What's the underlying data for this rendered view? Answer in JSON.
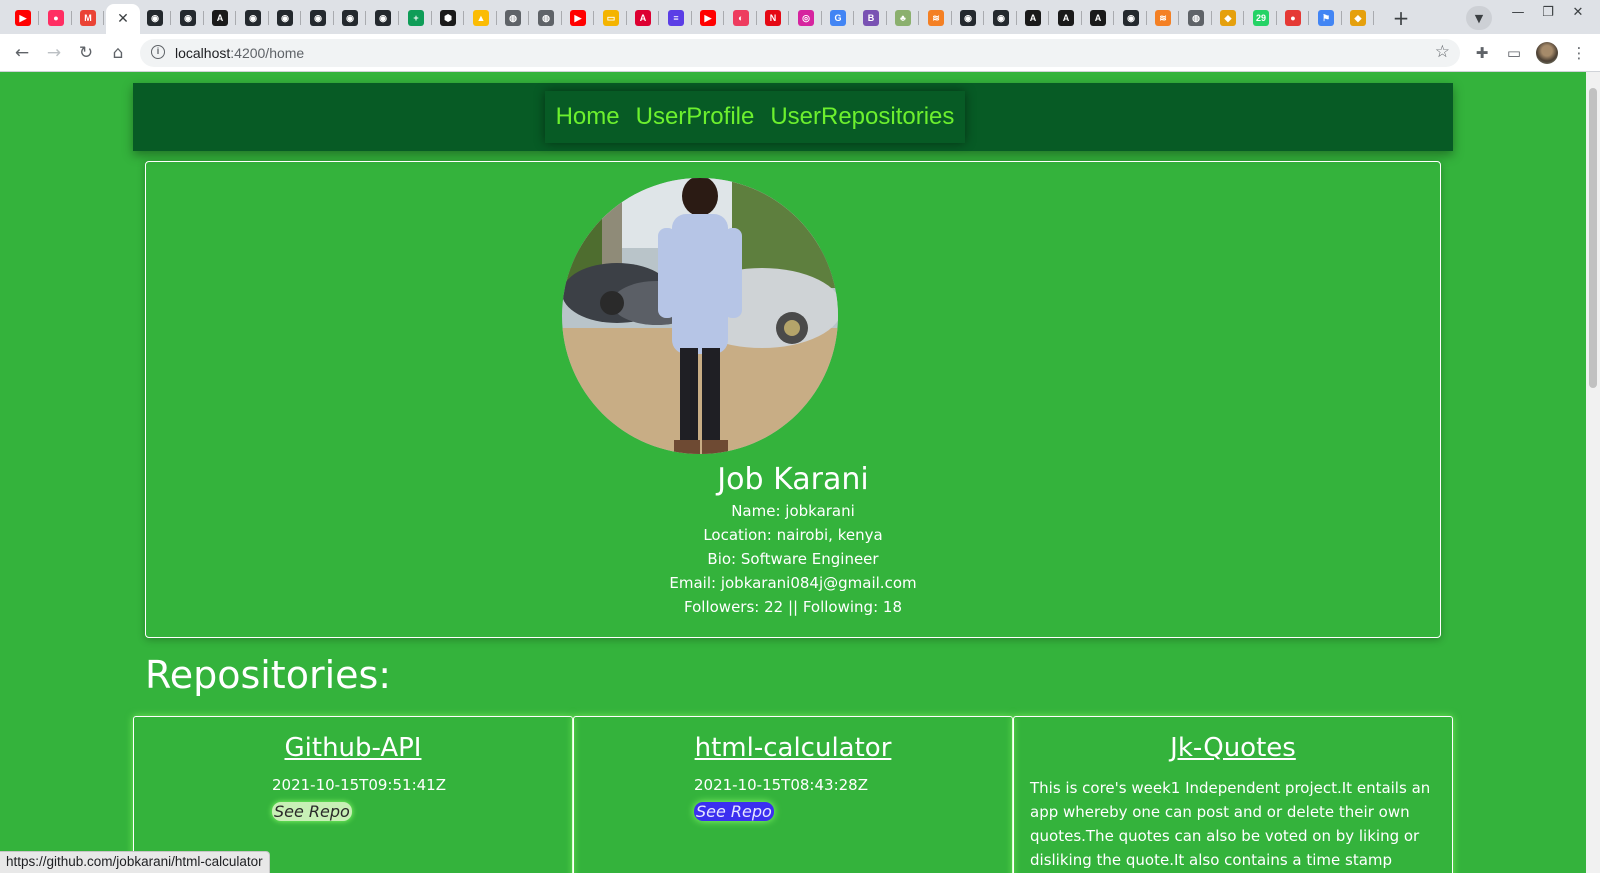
{
  "browser": {
    "tabs": [
      {
        "icon": "youtube-icon",
        "glyph": "▶",
        "color": "#ff0000"
      },
      {
        "icon": "music-icon",
        "glyph": "●",
        "color": "#ff2e63"
      },
      {
        "icon": "gmail-icon",
        "glyph": "M",
        "color": "#ea4335"
      },
      {
        "icon": "close-icon",
        "glyph": "✕",
        "color": "#ffffff",
        "active": true
      },
      {
        "icon": "github-icon",
        "glyph": "◉",
        "color": "#24292e"
      },
      {
        "icon": "github-icon",
        "glyph": "◉",
        "color": "#24292e"
      },
      {
        "icon": "angular-icon",
        "glyph": "A",
        "color": "#1a1a1a"
      },
      {
        "icon": "github-icon",
        "glyph": "◉",
        "color": "#24292e"
      },
      {
        "icon": "github-icon",
        "glyph": "◉",
        "color": "#24292e"
      },
      {
        "icon": "github-icon",
        "glyph": "◉",
        "color": "#24292e"
      },
      {
        "icon": "github-icon",
        "glyph": "◉",
        "color": "#24292e"
      },
      {
        "icon": "github-icon",
        "glyph": "◉",
        "color": "#24292e"
      },
      {
        "icon": "sheets-icon",
        "glyph": "+",
        "color": "#0f9d58"
      },
      {
        "icon": "hexagon-icon",
        "glyph": "⬢",
        "color": "#1a1a1a"
      },
      {
        "icon": "drive-icon",
        "glyph": "▲",
        "color": "#fbbc04"
      },
      {
        "icon": "globe-icon",
        "glyph": "◍",
        "color": "#5f6368"
      },
      {
        "icon": "globe-icon",
        "glyph": "◍",
        "color": "#5f6368"
      },
      {
        "icon": "youtube-icon",
        "glyph": "▶",
        "color": "#ff0000"
      },
      {
        "icon": "slides-icon",
        "glyph": "▭",
        "color": "#f4b400"
      },
      {
        "icon": "angular-red-icon",
        "glyph": "A",
        "color": "#dd0031"
      },
      {
        "icon": "list-icon",
        "glyph": "≡",
        "color": "#5b3ee6"
      },
      {
        "icon": "youtube-icon",
        "glyph": "▶",
        "color": "#ff0000"
      },
      {
        "icon": "app-icon",
        "glyph": "◐",
        "color": "#ee3c5f"
      },
      {
        "icon": "netflix-icon",
        "glyph": "N",
        "color": "#e50914"
      },
      {
        "icon": "instagram-icon",
        "glyph": "◎",
        "color": "#d6249f"
      },
      {
        "icon": "google-icon",
        "glyph": "G",
        "color": "#4285f4"
      },
      {
        "icon": "bootstrap-icon",
        "glyph": "B",
        "color": "#7952b3"
      },
      {
        "icon": "plant-icon",
        "glyph": "♣",
        "color": "#8bb06e"
      },
      {
        "icon": "stackoverflow-icon",
        "glyph": "≋",
        "color": "#f48024"
      },
      {
        "icon": "github-icon",
        "glyph": "◉",
        "color": "#24292e"
      },
      {
        "icon": "github-icon",
        "glyph": "◉",
        "color": "#24292e"
      },
      {
        "icon": "angular-icon",
        "glyph": "A",
        "color": "#1a1a1a"
      },
      {
        "icon": "angular-icon",
        "glyph": "A",
        "color": "#1a1a1a"
      },
      {
        "icon": "angular-icon",
        "glyph": "A",
        "color": "#1a1a1a"
      },
      {
        "icon": "github-icon",
        "glyph": "◉",
        "color": "#24292e"
      },
      {
        "icon": "stackoverflow-icon",
        "glyph": "≋",
        "color": "#f48024"
      },
      {
        "icon": "globe-icon",
        "glyph": "◍",
        "color": "#5f6368"
      },
      {
        "icon": "shield-icon",
        "glyph": "◆",
        "color": "#e5a00d"
      },
      {
        "icon": "badge-icon",
        "glyph": "29",
        "color": "#25d366"
      },
      {
        "icon": "record-icon",
        "glyph": "●",
        "color": "#e53935"
      },
      {
        "icon": "flag-icon",
        "glyph": "⚑",
        "color": "#4285f4"
      },
      {
        "icon": "shield-icon",
        "glyph": "◆",
        "color": "#e5a00d"
      }
    ],
    "url_host": "localhost",
    "url_path": ":4200/home"
  },
  "nav": {
    "links": [
      "Home",
      "UserProfile",
      "UserRepositories"
    ]
  },
  "profile": {
    "name": "Job Karani",
    "login_line": "Name: jobkarani",
    "location_line": "Location: nairobi, kenya",
    "bio_line": "Bio: Software Engineer",
    "email_line": "Email: jobkarani084j@gmail.com",
    "follow_line": "Followers: 22 || Following: 18"
  },
  "repositories": {
    "title": "Repositories:",
    "items": [
      {
        "name": "Github-API",
        "date": "2021-10-15T09:51:41Z",
        "link_label": "See Repo"
      },
      {
        "name": "html-calculator",
        "date": "2021-10-15T08:43:28Z",
        "link_label": "See Repo"
      },
      {
        "name": "Jk-Quotes",
        "description": "This is core's week1 Independent project.It entails an app whereby one can post and or delete their own quotes.The quotes can also be voted on by liking or disliking the quote.It also contains a time stamp"
      }
    ]
  },
  "status_url": "https://github.com/jobkarani/html-calculator",
  "colors": {
    "page_bg": "#34b33c",
    "navbar_bg": "#075b25",
    "nav_link": "#6cf02e",
    "link_hover_bg": "#3b2ff0"
  }
}
